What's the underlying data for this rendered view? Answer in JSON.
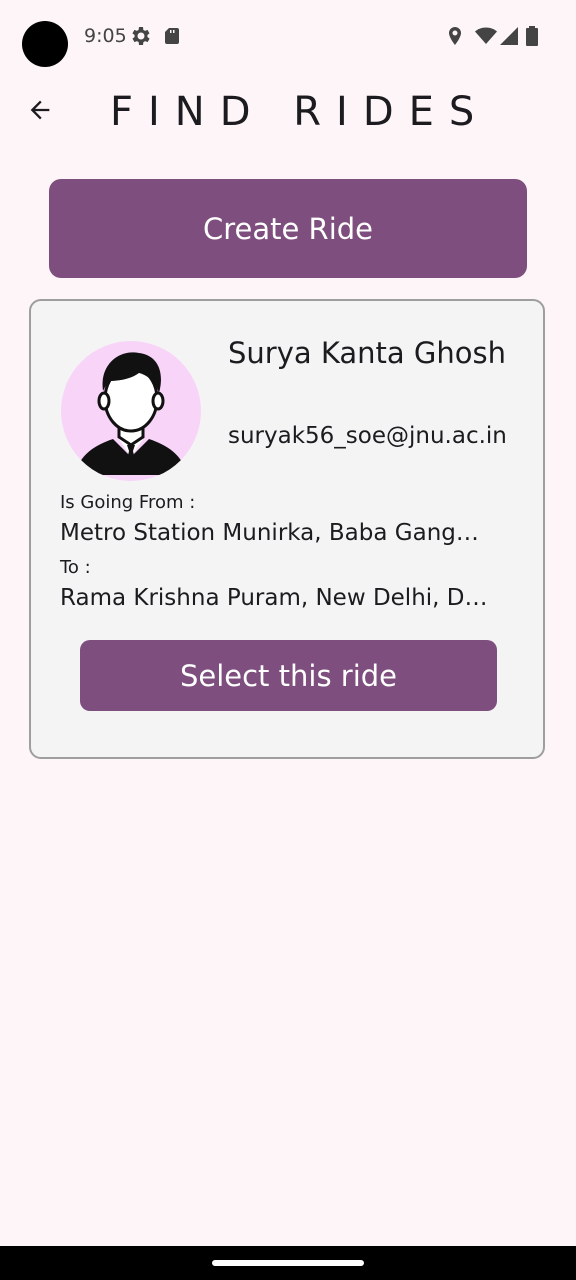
{
  "status_bar": {
    "time": "9:05",
    "icons": [
      "settings-icon",
      "sd-card-icon",
      "location-icon",
      "wifi-icon",
      "signal-icon",
      "battery-icon"
    ]
  },
  "app_bar": {
    "title": "FIND RIDES",
    "back_icon": "arrow-back-icon"
  },
  "create_ride": {
    "label": "Create Ride"
  },
  "rides": [
    {
      "driver_name": "Surya Kanta Ghosh",
      "driver_email": "suryak56_soe@jnu.ac.in",
      "from_label": "Is Going From :",
      "from_value": "Metro Station Munirka, Baba Gang…",
      "to_label": "To :",
      "to_value": "Rama Krishna Puram, New Delhi, D…",
      "select_label": "Select this ride",
      "avatar_icon": "person-avatar-icon"
    }
  ],
  "colors": {
    "background": "#fef5f8",
    "primary": "#7e4e7e",
    "card": "#f4f4f4",
    "avatar_bg": "#f9d4f9"
  }
}
